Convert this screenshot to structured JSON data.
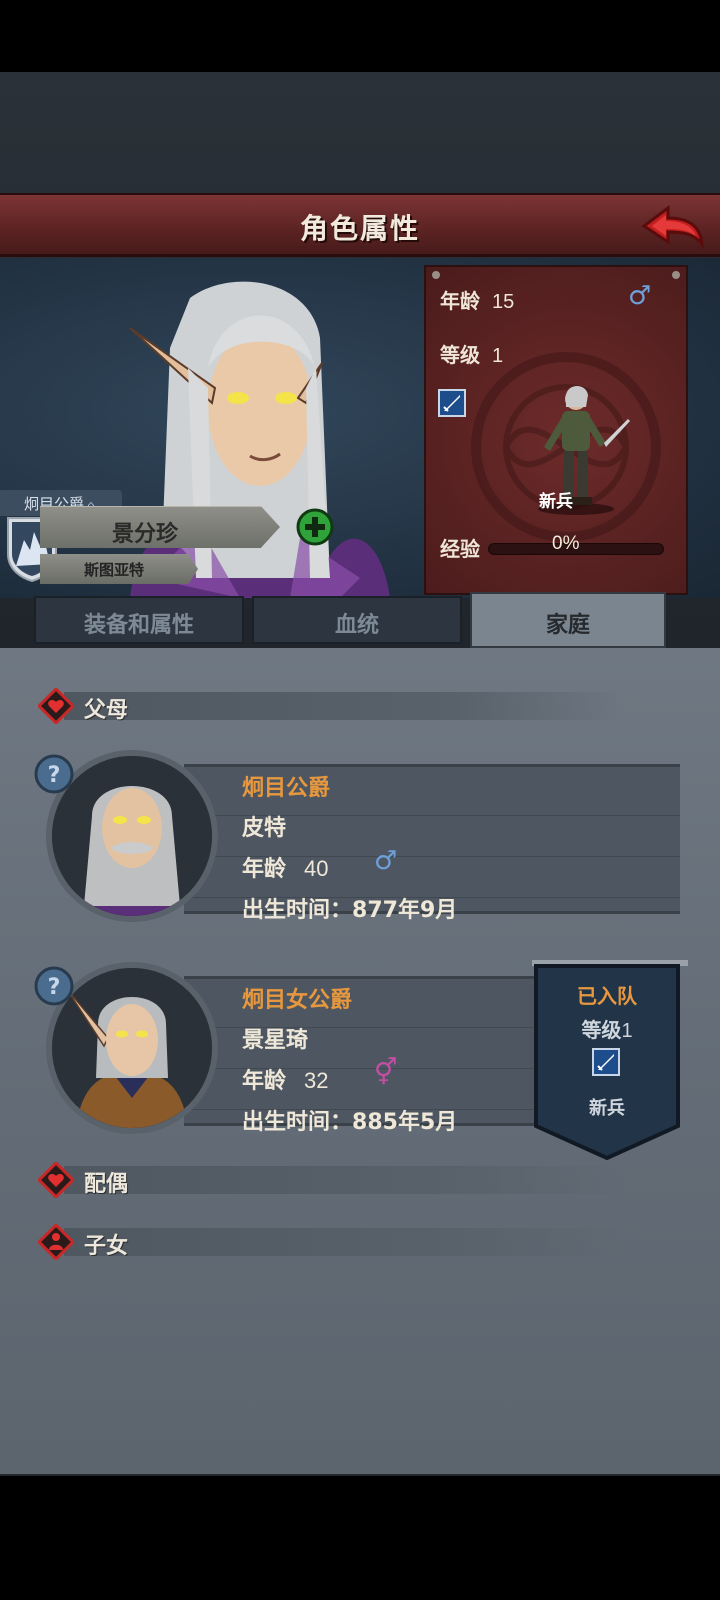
{
  "screen": {
    "title": "角色属性"
  },
  "hero": {
    "rank_title": "炯目公爵",
    "name": "景分珍",
    "realm": "斯图亚特",
    "stats": {
      "age_label": "年龄",
      "age_value": "15",
      "gender": "♂",
      "level_label": "等级",
      "level_value": "1",
      "unit_class": "新兵",
      "exp_label": "经验",
      "exp_value": "0%",
      "exp_fraction": 0
    }
  },
  "tabs": [
    {
      "label": "装备和属性",
      "active": false
    },
    {
      "label": "血统",
      "active": false
    },
    {
      "label": "家庭",
      "active": true
    }
  ],
  "family": {
    "parents_label": "父母",
    "spouse_label": "配偶",
    "children_label": "子女",
    "members": [
      {
        "title": "炯目公爵",
        "name": "皮特",
        "age_label": "年龄",
        "age": "40",
        "gender": "♂",
        "birth_label": "出生时间：",
        "birth": "877年9月",
        "help": "?"
      },
      {
        "title": "炯目女公爵",
        "name": "景星琦",
        "age_label": "年龄",
        "age": "32",
        "gender": "⚥",
        "birth_label": "出生时间：",
        "birth": "885年5月",
        "help": "?",
        "status": {
          "joined": "已入队",
          "level_label": "等级",
          "level": "1",
          "unit_class": "新兵"
        }
      }
    ]
  },
  "colors": {
    "accent_orange": "#e7983f",
    "male_blue": "#6f9fd8",
    "female_pink": "#c24fa5",
    "title_red": "#7d3434"
  }
}
